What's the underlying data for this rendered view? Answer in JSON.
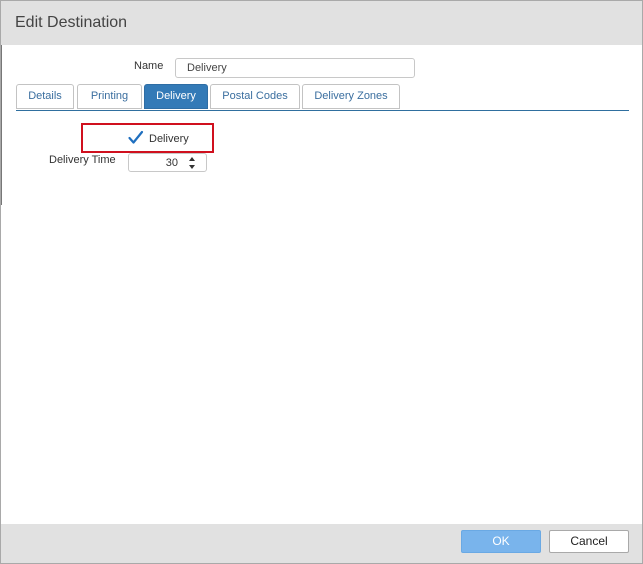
{
  "dialog": {
    "title": "Edit Destination"
  },
  "name_field": {
    "label": "Name",
    "value": "Delivery"
  },
  "tabs": [
    {
      "label": "Details",
      "active": false
    },
    {
      "label": "Printing",
      "active": false
    },
    {
      "label": "Delivery",
      "active": true
    },
    {
      "label": "Postal Codes",
      "active": false
    },
    {
      "label": "Delivery Zones",
      "active": false
    }
  ],
  "delivery_tab": {
    "delivery_checkbox": {
      "label": "Delivery",
      "checked": true
    },
    "delivery_time": {
      "label": "Delivery Time",
      "value": "30"
    }
  },
  "buttons": {
    "ok": "OK",
    "cancel": "Cancel"
  },
  "colors": {
    "accent": "#337ab7",
    "ok_button": "#79b4ec",
    "highlight_border": "#d0101e",
    "checkmark": "#1f6fbf"
  },
  "icons": {
    "checkbox": "checkmark-icon",
    "spin_up": "caret-up-icon",
    "spin_down": "caret-down-icon"
  }
}
